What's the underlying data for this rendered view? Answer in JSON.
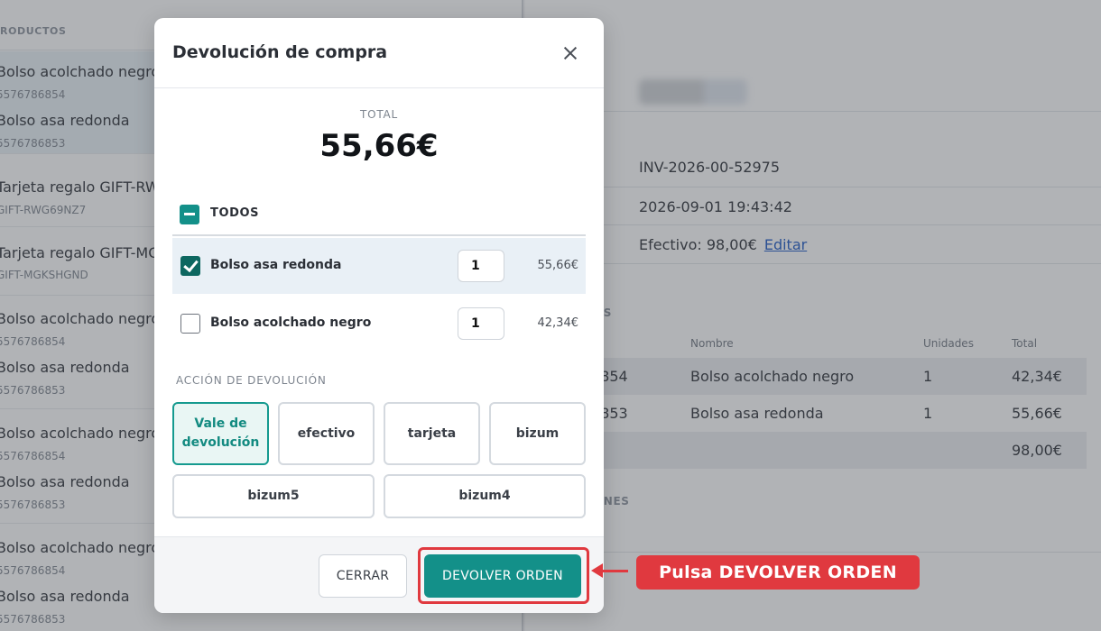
{
  "background": {
    "products_header": "RODUCTOS",
    "items": [
      {
        "name": "Bolso acolchado negro",
        "sku": "5576786854"
      },
      {
        "name": "Bolso asa redonda",
        "sku": "5576786853"
      },
      {
        "name": "Tarjeta regalo GIFT-RWG",
        "sku": "GIFT-RWG69NZ7"
      },
      {
        "name": "Tarjeta regalo GIFT-MGK",
        "sku": "GIFT-MGKSHGND"
      },
      {
        "name": "Bolso acolchado negro",
        "sku": "5576786854"
      },
      {
        "name": "Bolso asa redonda",
        "sku": "5576786853"
      },
      {
        "name": "Bolso acolchado negro",
        "sku": "5576786854"
      },
      {
        "name": "Bolso asa redonda",
        "sku": "5576786853"
      },
      {
        "name": "Bolso acolchado negro",
        "sku": "5576786854"
      },
      {
        "name": "Bolso asa redonda",
        "sku": "5576786853"
      }
    ],
    "invoice": "INV-2026-00-52975",
    "datetime": "2026-09-01 19:43:42",
    "payment": "Efectivo: 98,00€",
    "edit_link": "Editar",
    "section_products": "OS",
    "table_headers": [
      "Nombre",
      "Unidades",
      "Total"
    ],
    "table_rows": [
      {
        "ref": "6854",
        "name": "Bolso acolchado negro",
        "units": "1",
        "total": "42,34€"
      },
      {
        "ref": "6853",
        "name": "Bolso asa redonda",
        "units": "1",
        "total": "55,66€"
      }
    ],
    "table_total": "98,00€",
    "section_notes": "ONES"
  },
  "modal": {
    "title": "Devolución de compra",
    "total_label": "TOTAL",
    "total_value": "55,66€",
    "all_label": "TODOS",
    "products": [
      {
        "name": "Bolso asa redonda",
        "qty": "1",
        "price": "55,66€",
        "checked": true
      },
      {
        "name": "Bolso acolchado negro",
        "qty": "1",
        "price": "42,34€",
        "checked": false
      }
    ],
    "action_label": "ACCIÓN DE DEVOLUCIÓN",
    "actions": [
      "Vale de devolución",
      "efectivo",
      "tarjeta",
      "bizum",
      "bizum5",
      "bizum4"
    ],
    "cancel_label": "CERRAR",
    "confirm_label": "DEVOLVER ORDEN"
  },
  "annotation": {
    "callout_text": "Pulsa DEVOLVER ORDEN",
    "color": "#e0393f"
  },
  "colors": {
    "accent": "#139089",
    "accent_dark": "#0d6760"
  }
}
